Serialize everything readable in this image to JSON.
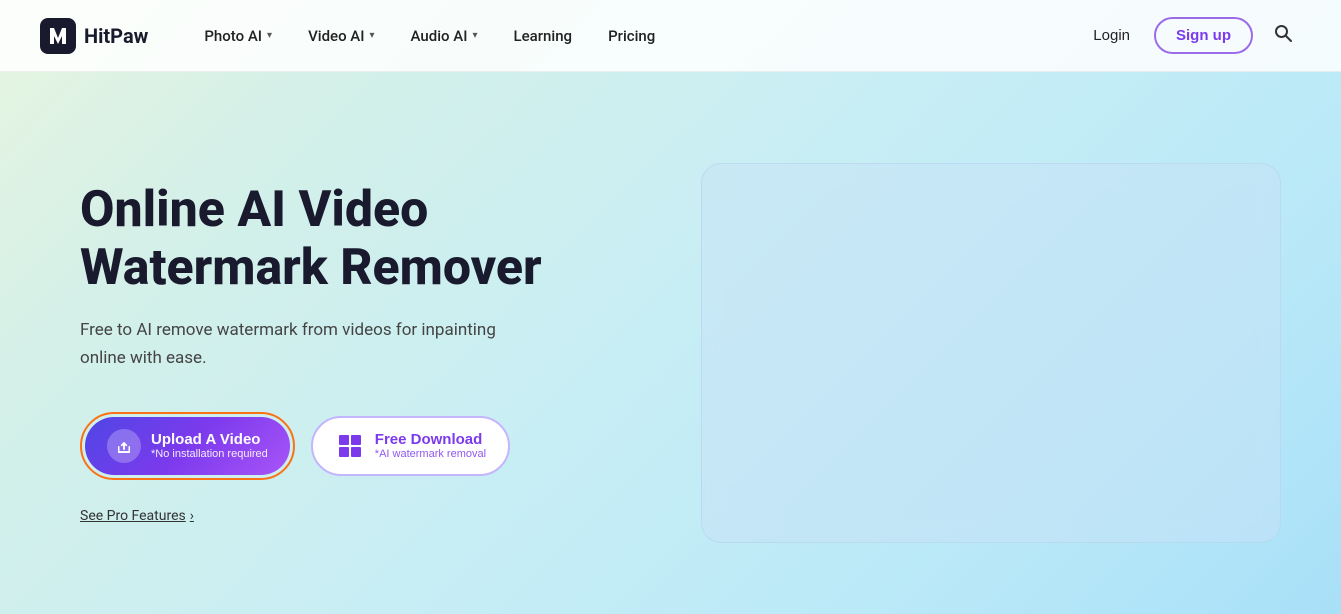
{
  "brand": {
    "name": "HitPaw",
    "logo_alt": "HitPaw logo"
  },
  "navbar": {
    "items": [
      {
        "label": "Photo AI",
        "has_dropdown": true
      },
      {
        "label": "Video AI",
        "has_dropdown": true
      },
      {
        "label": "Audio AI",
        "has_dropdown": true
      },
      {
        "label": "Learning",
        "has_dropdown": false
      },
      {
        "label": "Pricing",
        "has_dropdown": false
      }
    ],
    "login_label": "Login",
    "signup_label": "Sign up",
    "search_icon": "🔍"
  },
  "hero": {
    "title_line1": "Online AI Video",
    "title_line2": "Watermark Remover",
    "subtitle": "Free to AI remove watermark from videos for inpainting online with ease.",
    "upload_button": {
      "main": "Upload A Video",
      "sub": "*No installation required"
    },
    "download_button": {
      "main": "Free Download",
      "sub": "*AI watermark removal"
    },
    "see_pro": "See Pro Features",
    "see_pro_arrow": "›"
  }
}
